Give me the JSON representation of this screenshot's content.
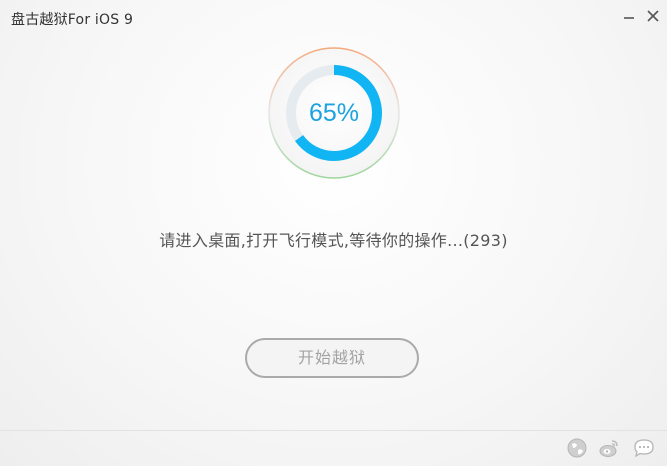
{
  "window": {
    "title": "盘古越狱For iOS 9"
  },
  "titlebar_buttons": [
    {
      "name": "minimize",
      "icon": "minimize-icon"
    },
    {
      "name": "close",
      "icon": "close-icon"
    }
  ],
  "progress": {
    "percent_label": "65%",
    "value": 0.65,
    "arc_color": "#12b5f3",
    "track_color": "#e6ebef",
    "ring_gradient": [
      "#f5a87a",
      "#9fd59c"
    ]
  },
  "status": {
    "message": "请进入桌面,打开飞行模式,等待你的操作...(293)"
  },
  "actions": {
    "start_label": "开始越狱"
  },
  "footer": {
    "icons": [
      "globe-icon",
      "weibo-icon",
      "chat-icon"
    ]
  }
}
